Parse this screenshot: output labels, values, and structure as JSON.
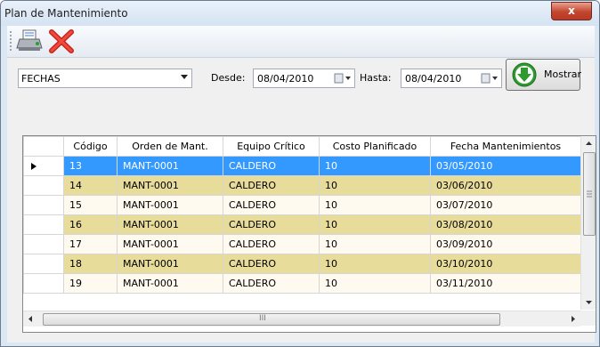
{
  "window": {
    "title": "Plan de Mantenimiento",
    "close_label": "x"
  },
  "toolbar": {
    "print_icon": "printer-icon",
    "cancel_icon": "red-x-icon"
  },
  "filter": {
    "combo_value": "FECHAS",
    "desde_label": "Desde:",
    "desde_value": "08/04/2010",
    "hasta_label": "Hasta:",
    "hasta_value": "08/04/2010",
    "mostrar_label": "Mostrar"
  },
  "grid": {
    "columns": [
      "Código",
      "Orden de Mant.",
      "Equipo Crítico",
      "Costo Planificado",
      "Fecha Mantenimientos"
    ],
    "rows": [
      [
        "13",
        "MANT-0001",
        "CALDERO",
        "10",
        "03/05/2010"
      ],
      [
        "14",
        "MANT-0001",
        "CALDERO",
        "10",
        "03/06/2010"
      ],
      [
        "15",
        "MANT-0001",
        "CALDERO",
        "10",
        "03/07/2010"
      ],
      [
        "16",
        "MANT-0001",
        "CALDERO",
        "10",
        "03/08/2010"
      ],
      [
        "17",
        "MANT-0001",
        "CALDERO",
        "10",
        "03/09/2010"
      ],
      [
        "18",
        "MANT-0001",
        "CALDERO",
        "10",
        "03/10/2010"
      ],
      [
        "19",
        "MANT-0001",
        "CALDERO",
        "10",
        "03/11/2010"
      ]
    ],
    "selected_row": 0,
    "hscroll_thumb_label": "III"
  },
  "colors": {
    "selected": "#3399ff",
    "alt_row": "#e8dc9a",
    "row": "#fffaf0"
  }
}
